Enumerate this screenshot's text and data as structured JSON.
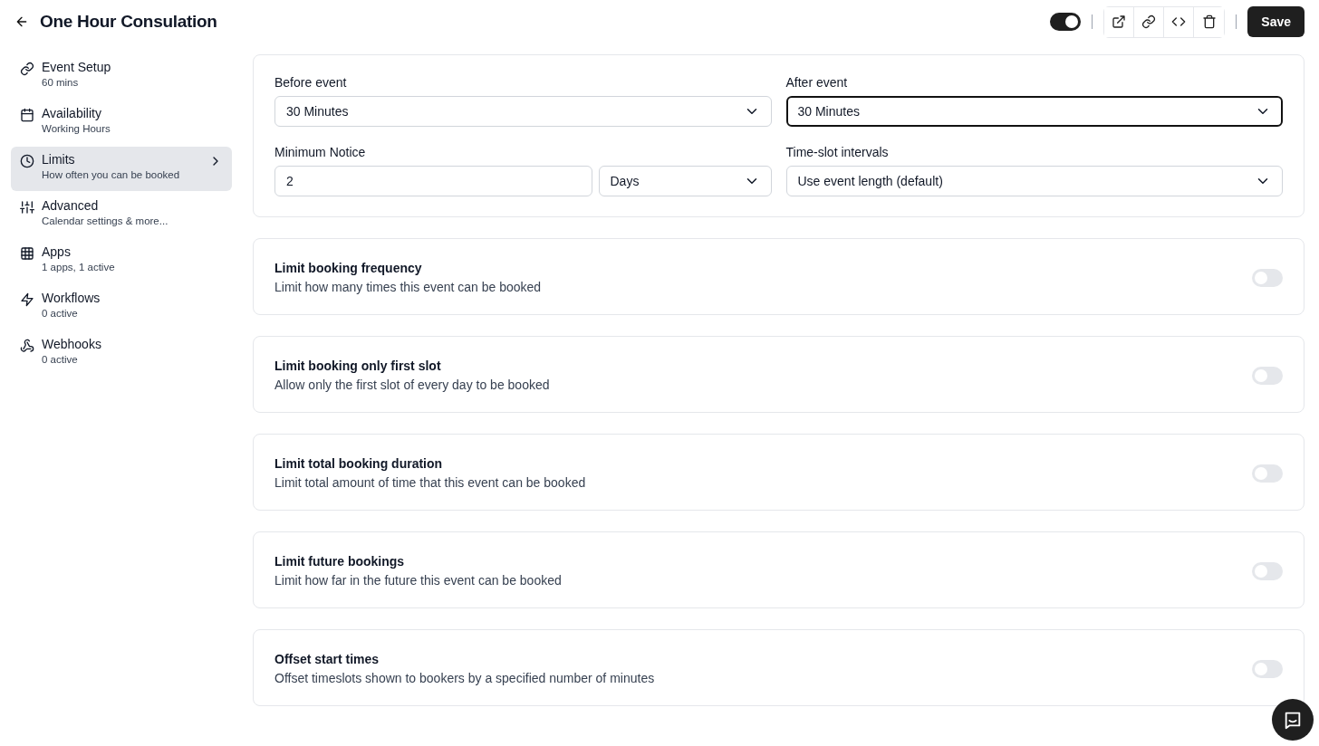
{
  "header": {
    "title": "One Hour Consulation",
    "enabled": true,
    "save_label": "Save"
  },
  "sidebar": {
    "items": [
      {
        "label": "Event Setup",
        "sublabel": "60 mins",
        "selected": false
      },
      {
        "label": "Availability",
        "sublabel": "Working Hours",
        "selected": false
      },
      {
        "label": "Limits",
        "sublabel": "How often you can be booked",
        "selected": true
      },
      {
        "label": "Advanced",
        "sublabel": "Calendar settings & more...",
        "selected": false
      },
      {
        "label": "Apps",
        "sublabel": "1 apps, 1 active",
        "selected": false
      },
      {
        "label": "Workflows",
        "sublabel": "0 active",
        "selected": false
      },
      {
        "label": "Webhooks",
        "sublabel": "0 active",
        "selected": false
      }
    ]
  },
  "buffers": {
    "before_event": {
      "label": "Before event",
      "value": "30 Minutes",
      "focused": false
    },
    "after_event": {
      "label": "After event",
      "value": "30 Minutes",
      "focused": true
    },
    "minimum_notice": {
      "label": "Minimum Notice",
      "value": "2",
      "unit": "Days",
      "focused": false
    },
    "time_slot_intervals": {
      "label": "Time-slot intervals",
      "value": "Use event length (default)",
      "focused": false
    }
  },
  "limits": [
    {
      "title": "Limit booking frequency",
      "description": "Limit how many times this event can be booked",
      "on": false
    },
    {
      "title": "Limit booking only first slot",
      "description": "Allow only the first slot of every day to be booked",
      "on": false
    },
    {
      "title": "Limit total booking duration",
      "description": "Limit total amount of time that this event can be booked",
      "on": false
    },
    {
      "title": "Limit future bookings",
      "description": "Limit how far in the future this event can be booked",
      "on": false
    },
    {
      "title": "Offset start times",
      "description": "Offset timeslots shown to bookers by a specified number of minutes",
      "on": false
    }
  ]
}
